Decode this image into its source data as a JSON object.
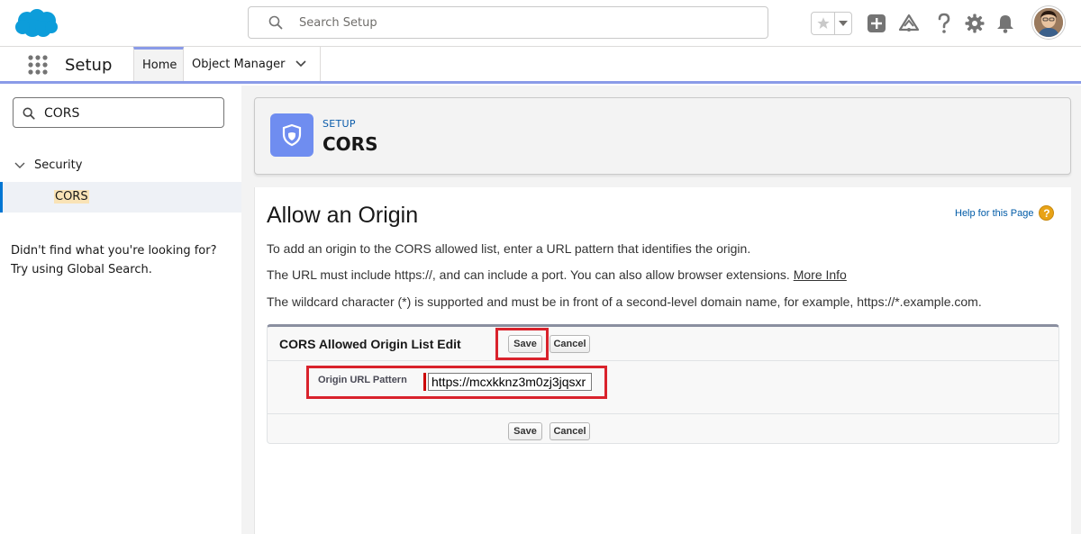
{
  "header": {
    "search_placeholder": "Search Setup",
    "brand_color": "#0d9dda"
  },
  "app_nav": {
    "app_name": "Setup",
    "tabs": [
      {
        "label": "Home",
        "active": true
      },
      {
        "label": "Object Manager",
        "has_menu": true
      }
    ]
  },
  "sidebar": {
    "search_value": "CORS",
    "tree": {
      "group_label": "Security",
      "expanded": true,
      "items": [
        {
          "label": "CORS",
          "selected": true
        }
      ]
    },
    "help_text": "Didn't find what you're looking for? Try using Global Search."
  },
  "page_header": {
    "eyebrow": "SETUP",
    "title": "CORS",
    "icon": "shield-icon"
  },
  "content": {
    "title": "Allow an Origin",
    "help_link": "Help for this Page",
    "paragraphs": [
      "To add an origin to the CORS allowed list, enter a URL pattern that identifies the origin.",
      "The URL must include https://, and can include a port. You can also allow browser extensions. ",
      "The wildcard character (*) is supported and must be in front of a second-level domain name, for example, https://*.example.com."
    ],
    "more_info_link": "More Info",
    "edit_section": {
      "title": "CORS Allowed Origin List Edit",
      "save_label": "Save",
      "cancel_label": "Cancel",
      "field_label": "Origin URL Pattern",
      "field_value": "https://mcxkknz3m0zj3jqsxr"
    }
  }
}
